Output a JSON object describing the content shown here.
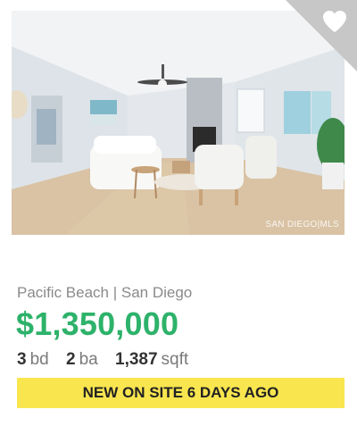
{
  "listing": {
    "location": "Pacific Beach | San Diego",
    "price": "$1,350,000",
    "beds": "3",
    "beds_unit": "bd",
    "baths": "2",
    "baths_unit": "ba",
    "sqft": "1,387",
    "sqft_unit": "sqft",
    "badge": "NEW ON SITE 6 DAYS AGO",
    "photo_watermark": "SAN DIEGO|MLS"
  },
  "favorite": {
    "icon": "heart-icon"
  },
  "colors": {
    "price": "#2db26a",
    "badge_bg": "#f9e64f",
    "favorite_corner": "#c7c7c7"
  }
}
